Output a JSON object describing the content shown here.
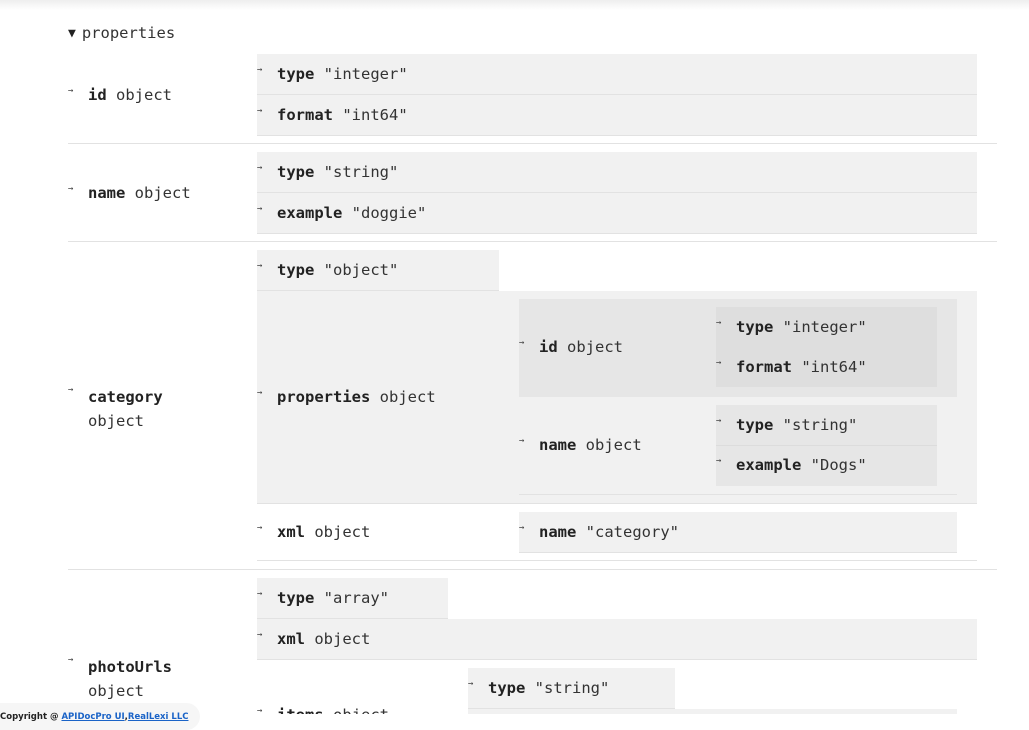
{
  "toggle": {
    "arrow": "▼",
    "label": "properties"
  },
  "id": {
    "key": "id",
    "val": "object",
    "rows": [
      {
        "key": "type",
        "val": "\"integer\""
      },
      {
        "key": "format",
        "val": "\"int64\""
      }
    ]
  },
  "name": {
    "key": "name",
    "val": "object",
    "rows": [
      {
        "key": "type",
        "val": "\"string\""
      },
      {
        "key": "example",
        "val": "\"doggie\""
      }
    ]
  },
  "category": {
    "key": "category",
    "val": "object",
    "type_row": {
      "key": "type",
      "val": "\"object\""
    },
    "properties": {
      "key": "properties",
      "val": "object",
      "id": {
        "key": "id",
        "val": "object",
        "rows": [
          {
            "key": "type",
            "val": "\"integer\""
          },
          {
            "key": "format",
            "val": "\"int64\""
          }
        ]
      },
      "name": {
        "key": "name",
        "val": "object",
        "rows": [
          {
            "key": "type",
            "val": "\"string\""
          },
          {
            "key": "example",
            "val": "\"Dogs\""
          }
        ]
      }
    },
    "xml": {
      "key": "xml",
      "val": "object",
      "name_row": {
        "key": "name",
        "val": "\"category\""
      }
    }
  },
  "photoUrls": {
    "key": "photoUrls",
    "val": "object",
    "type_row": {
      "key": "type",
      "val": "\"array\""
    },
    "xml_row": {
      "key": "xml",
      "val": "object"
    },
    "items": {
      "key": "items",
      "val": "object",
      "type_row": {
        "key": "type",
        "val": "\"string\""
      }
    }
  },
  "footer": {
    "text": "Copyright @",
    "link1": "APIDocPro UI",
    "sep": ",",
    "link2": "RealLexi LLC"
  },
  "icons": {
    "row_arrow": "→",
    "toggle_arrow": "▼"
  }
}
